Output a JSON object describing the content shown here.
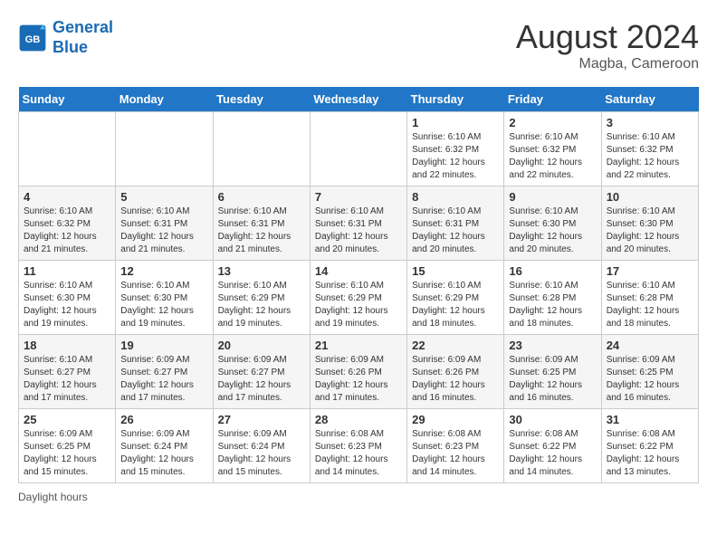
{
  "header": {
    "logo_line1": "General",
    "logo_line2": "Blue",
    "month_year": "August 2024",
    "location": "Magba, Cameroon"
  },
  "days_of_week": [
    "Sunday",
    "Monday",
    "Tuesday",
    "Wednesday",
    "Thursday",
    "Friday",
    "Saturday"
  ],
  "weeks": [
    [
      {
        "day": "",
        "text": ""
      },
      {
        "day": "",
        "text": ""
      },
      {
        "day": "",
        "text": ""
      },
      {
        "day": "",
        "text": ""
      },
      {
        "day": "1",
        "text": "Sunrise: 6:10 AM\nSunset: 6:32 PM\nDaylight: 12 hours and 22 minutes."
      },
      {
        "day": "2",
        "text": "Sunrise: 6:10 AM\nSunset: 6:32 PM\nDaylight: 12 hours and 22 minutes."
      },
      {
        "day": "3",
        "text": "Sunrise: 6:10 AM\nSunset: 6:32 PM\nDaylight: 12 hours and 22 minutes."
      }
    ],
    [
      {
        "day": "4",
        "text": "Sunrise: 6:10 AM\nSunset: 6:32 PM\nDaylight: 12 hours and 21 minutes."
      },
      {
        "day": "5",
        "text": "Sunrise: 6:10 AM\nSunset: 6:31 PM\nDaylight: 12 hours and 21 minutes."
      },
      {
        "day": "6",
        "text": "Sunrise: 6:10 AM\nSunset: 6:31 PM\nDaylight: 12 hours and 21 minutes."
      },
      {
        "day": "7",
        "text": "Sunrise: 6:10 AM\nSunset: 6:31 PM\nDaylight: 12 hours and 20 minutes."
      },
      {
        "day": "8",
        "text": "Sunrise: 6:10 AM\nSunset: 6:31 PM\nDaylight: 12 hours and 20 minutes."
      },
      {
        "day": "9",
        "text": "Sunrise: 6:10 AM\nSunset: 6:30 PM\nDaylight: 12 hours and 20 minutes."
      },
      {
        "day": "10",
        "text": "Sunrise: 6:10 AM\nSunset: 6:30 PM\nDaylight: 12 hours and 20 minutes."
      }
    ],
    [
      {
        "day": "11",
        "text": "Sunrise: 6:10 AM\nSunset: 6:30 PM\nDaylight: 12 hours and 19 minutes."
      },
      {
        "day": "12",
        "text": "Sunrise: 6:10 AM\nSunset: 6:30 PM\nDaylight: 12 hours and 19 minutes."
      },
      {
        "day": "13",
        "text": "Sunrise: 6:10 AM\nSunset: 6:29 PM\nDaylight: 12 hours and 19 minutes."
      },
      {
        "day": "14",
        "text": "Sunrise: 6:10 AM\nSunset: 6:29 PM\nDaylight: 12 hours and 19 minutes."
      },
      {
        "day": "15",
        "text": "Sunrise: 6:10 AM\nSunset: 6:29 PM\nDaylight: 12 hours and 18 minutes."
      },
      {
        "day": "16",
        "text": "Sunrise: 6:10 AM\nSunset: 6:28 PM\nDaylight: 12 hours and 18 minutes."
      },
      {
        "day": "17",
        "text": "Sunrise: 6:10 AM\nSunset: 6:28 PM\nDaylight: 12 hours and 18 minutes."
      }
    ],
    [
      {
        "day": "18",
        "text": "Sunrise: 6:10 AM\nSunset: 6:27 PM\nDaylight: 12 hours and 17 minutes."
      },
      {
        "day": "19",
        "text": "Sunrise: 6:09 AM\nSunset: 6:27 PM\nDaylight: 12 hours and 17 minutes."
      },
      {
        "day": "20",
        "text": "Sunrise: 6:09 AM\nSunset: 6:27 PM\nDaylight: 12 hours and 17 minutes."
      },
      {
        "day": "21",
        "text": "Sunrise: 6:09 AM\nSunset: 6:26 PM\nDaylight: 12 hours and 17 minutes."
      },
      {
        "day": "22",
        "text": "Sunrise: 6:09 AM\nSunset: 6:26 PM\nDaylight: 12 hours and 16 minutes."
      },
      {
        "day": "23",
        "text": "Sunrise: 6:09 AM\nSunset: 6:25 PM\nDaylight: 12 hours and 16 minutes."
      },
      {
        "day": "24",
        "text": "Sunrise: 6:09 AM\nSunset: 6:25 PM\nDaylight: 12 hours and 16 minutes."
      }
    ],
    [
      {
        "day": "25",
        "text": "Sunrise: 6:09 AM\nSunset: 6:25 PM\nDaylight: 12 hours and 15 minutes."
      },
      {
        "day": "26",
        "text": "Sunrise: 6:09 AM\nSunset: 6:24 PM\nDaylight: 12 hours and 15 minutes."
      },
      {
        "day": "27",
        "text": "Sunrise: 6:09 AM\nSunset: 6:24 PM\nDaylight: 12 hours and 15 minutes."
      },
      {
        "day": "28",
        "text": "Sunrise: 6:08 AM\nSunset: 6:23 PM\nDaylight: 12 hours and 14 minutes."
      },
      {
        "day": "29",
        "text": "Sunrise: 6:08 AM\nSunset: 6:23 PM\nDaylight: 12 hours and 14 minutes."
      },
      {
        "day": "30",
        "text": "Sunrise: 6:08 AM\nSunset: 6:22 PM\nDaylight: 12 hours and 14 minutes."
      },
      {
        "day": "31",
        "text": "Sunrise: 6:08 AM\nSunset: 6:22 PM\nDaylight: 12 hours and 13 minutes."
      }
    ]
  ],
  "footer": {
    "label": "Daylight hours"
  }
}
